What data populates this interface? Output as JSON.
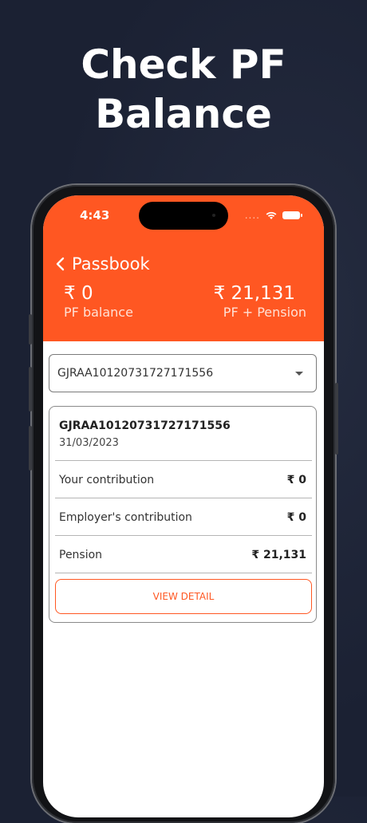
{
  "headline": {
    "line1": "Check PF",
    "line2": "Balance"
  },
  "status_bar": {
    "time": "4:43",
    "dots": "...."
  },
  "header": {
    "title": "Passbook",
    "pf_balance": {
      "amount": "₹ 0",
      "label": "PF balance"
    },
    "pf_pension": {
      "amount": "₹ 21,131",
      "label": "PF + Pension"
    }
  },
  "account_select": {
    "selected": "GJRAA10120731727171556"
  },
  "passbook_card": {
    "account": "GJRAA10120731727171556",
    "date": "31/03/2023",
    "rows": [
      {
        "label": "Your contribution",
        "value": "₹ 0"
      },
      {
        "label": "Employer's contribution",
        "value": "₹ 0"
      },
      {
        "label": "Pension",
        "value": "₹ 21,131"
      }
    ],
    "view_detail_label": "VIEW DETAIL"
  },
  "colors": {
    "accent": "#ff5722",
    "background": "#1b2133"
  }
}
